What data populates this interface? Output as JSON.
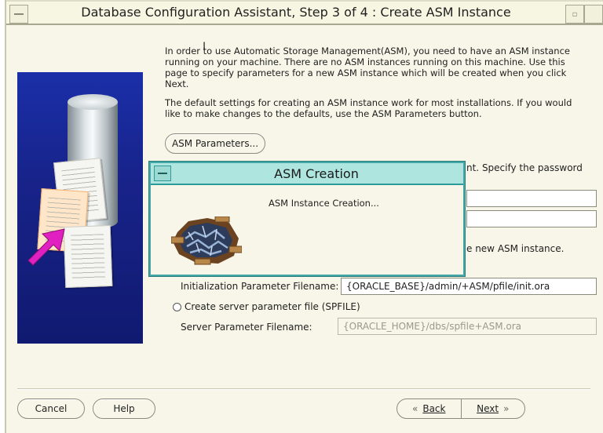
{
  "window": {
    "title": "Database Configuration Assistant, Step 3 of 4 : Create ASM Instance"
  },
  "intro": {
    "paragraph1": "In order to use Automatic Storage Management(ASM), you need to have an ASM instance running on your machine. There are no ASM instances running on this machine. Use this page to specify parameters for a new ASM instance which will be created when you click Next.",
    "paragraph2": "The default settings for creating an ASM instance work for most installations. If you would like to make changes to the defaults, use the ASM Parameters button."
  },
  "buttons": {
    "asm_parameters": "ASM Parameters...",
    "cancel": "Cancel",
    "help": "Help",
    "back": "Back",
    "next": "Next"
  },
  "partial": {
    "password_text": "nt. Specify the password",
    "new_instance_text": "e new ASM instance."
  },
  "init_param": {
    "label": "Initialization Parameter Filename:",
    "value": "{ORACLE_BASE}/admin/+ASM/pfile/init.ora"
  },
  "spfile": {
    "radio_label": "Create server parameter file (SPFILE)",
    "label": "Server Parameter Filename:",
    "value": "{ORACLE_HOME}/dbs/spfile+ASM.ora"
  },
  "dialog": {
    "title": "ASM Creation",
    "message": "ASM Instance Creation..."
  },
  "colors": {
    "window_bg": "#f7f6e8",
    "dialog_border": "#44a8a8",
    "dialog_title_bg": "#aee6df",
    "side_panel": "#1a2fa8",
    "arrow": "#e020c0"
  },
  "icons": [
    "window-menu-icon",
    "minimize-icon",
    "maximize-icon",
    "database-cylinder-icon",
    "document-icon",
    "arrow-icon",
    "brick-wall-animation-icon",
    "chevron-left-icon",
    "chevron-right-icon"
  ]
}
